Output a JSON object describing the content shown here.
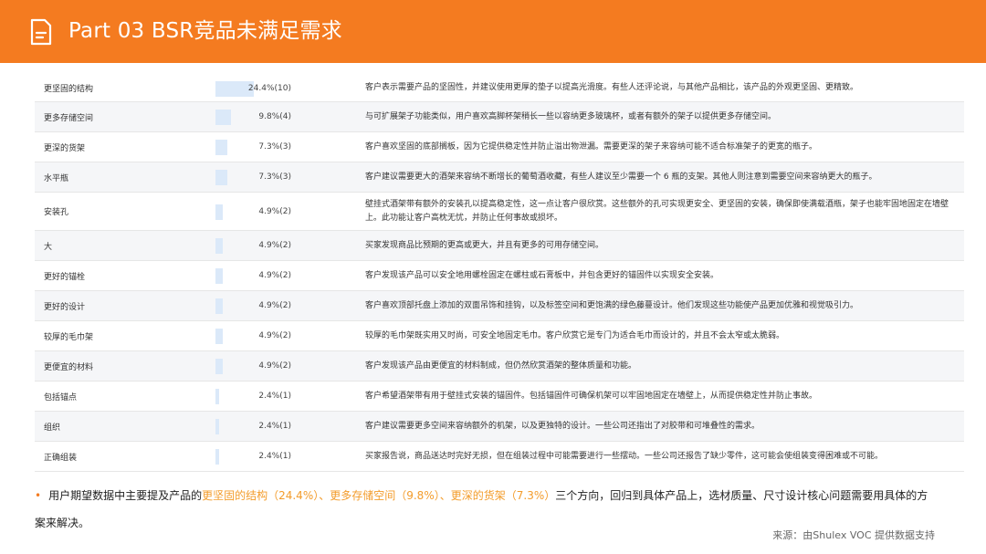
{
  "header": {
    "title": "Part 03  BSR竞品未满足需求",
    "icon": "document-icon",
    "color": "#f47b20"
  },
  "table": {
    "bar_max": 24.4,
    "rows": [
      {
        "name": "更坚固的结构",
        "value": 24.4,
        "pct": "24.4%(10)",
        "desc": "客户表示需要产品的坚固性，并建议使用更厚的垫子以提高光滑度。有些人还评论说，与其他产品相比，该产品的外观更坚固、更精致。"
      },
      {
        "name": "更多存储空间",
        "value": 9.8,
        "pct": "9.8%(4)",
        "desc": "与可扩展架子功能类似，用户喜欢高脚杯架稍长一些以容纳更多玻璃杯，或者有额外的架子以提供更多存储空间。"
      },
      {
        "name": "更深的货架",
        "value": 7.3,
        "pct": "7.3%(3)",
        "desc": "客户喜欢坚固的底部搁板，因为它提供稳定性并防止溢出物泄漏。需要更深的架子来容纳可能不适合标准架子的更宽的瓶子。"
      },
      {
        "name": "水平瓶",
        "value": 7.3,
        "pct": "7.3%(3)",
        "desc": "客户建议需要更大的酒架来容纳不断增长的葡萄酒收藏，有些人建议至少需要一个 6 瓶的支架。其他人则注意到需要空间来容纳更大的瓶子。"
      },
      {
        "name": "安装孔",
        "value": 4.9,
        "pct": "4.9%(2)",
        "desc": "壁挂式酒架带有额外的安装孔以提高稳定性，这一点让客户很欣赏。这些额外的孔可实现更安全、更坚固的安装，确保即使满载酒瓶，架子也能牢固地固定在墙壁上。此功能让客户高枕无忧，并防止任何事故或损坏。"
      },
      {
        "name": "大",
        "value": 4.9,
        "pct": "4.9%(2)",
        "desc": "买家发现商品比预期的更高或更大，并且有更多的可用存储空间。"
      },
      {
        "name": "更好的锚栓",
        "value": 4.9,
        "pct": "4.9%(2)",
        "desc": "客户发现该产品可以安全地用螺栓固定在螺柱或石膏板中，并包含更好的锚固件以实现安全安装。"
      },
      {
        "name": "更好的设计",
        "value": 4.9,
        "pct": "4.9%(2)",
        "desc": "客户喜欢顶部托盘上添加的双面吊饰和挂钩，以及标签空间和更饱满的绿色藤蔓设计。他们发现这些功能使产品更加优雅和视觉吸引力。"
      },
      {
        "name": "较厚的毛巾架",
        "value": 4.9,
        "pct": "4.9%(2)",
        "desc": "较厚的毛巾架既实用又时尚，可安全地固定毛巾。客户欣赏它是专门为适合毛巾而设计的，并且不会太窄或太脆弱。"
      },
      {
        "name": "更便宜的材料",
        "value": 4.9,
        "pct": "4.9%(2)",
        "desc": "客户发现该产品由更便宜的材料制成，但仍然欣赏酒架的整体质量和功能。"
      },
      {
        "name": "包括锚点",
        "value": 2.4,
        "pct": "2.4%(1)",
        "desc": "客户希望酒架带有用于壁挂式安装的锚固件。包括锚固件可确保机架可以牢固地固定在墙壁上，从而提供稳定性并防止事故。"
      },
      {
        "name": "组织",
        "value": 2.4,
        "pct": "2.4%(1)",
        "desc": "客户建议需要更多空间来容纳额外的机架，以及更独特的设计。一些公司还指出了对胶带和可堆叠性的需求。"
      },
      {
        "name": "正确组装",
        "value": 2.4,
        "pct": "2.4%(1)",
        "desc": "买家报告说，商品送达时完好无损，但在组装过程中可能需要进行一些摆动。一些公司还报告了缺少零件，这可能会使组装变得困难或不可能。"
      }
    ]
  },
  "summary": {
    "prefix": "用户期望数据中主要提及产品的",
    "hl1": "更坚固的结构（24.4%）",
    "sep1": "、",
    "hl2": "更多存储空间（9.8%）",
    "sep2": "、",
    "hl3": "更深的货架（7.3%）",
    "suffix": "三个方向，回归到具体产品上，选材质量、尺寸设计核心问题需要用具体的方案来解决。"
  },
  "source": "来源：由Shulex VOC 提供数据支持"
}
